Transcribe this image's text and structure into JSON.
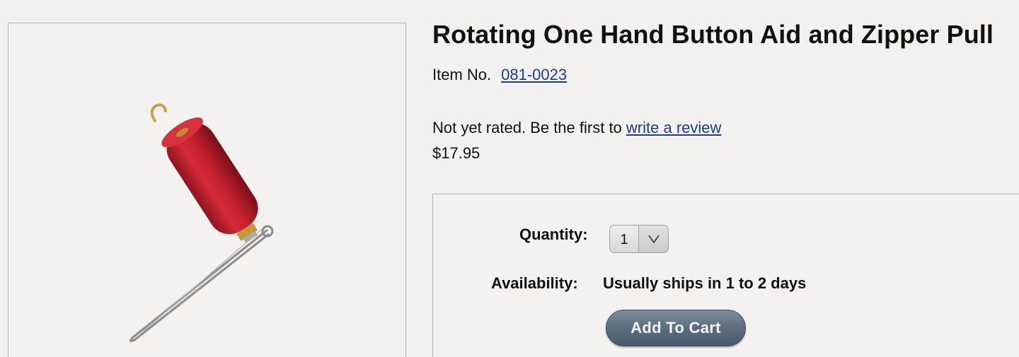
{
  "product": {
    "title": "Rotating One Hand Button Aid and Zipper Pull",
    "item_label": "Item No.",
    "item_number": "081-0023",
    "rating_text": "Not yet rated. Be the first to",
    "review_link": "write a review",
    "price": "$17.95",
    "image": {
      "alt": "red-handled button hook with wire loop",
      "handle_color": "#c9202f",
      "wire_color": "#9a9a9a",
      "ferrule_color": "#c39a3a"
    }
  },
  "purchase": {
    "quantity_label": "Quantity:",
    "quantity_value": "1",
    "availability_label": "Availability:",
    "availability_value": "Usually ships in 1 to 2 days",
    "add_to_cart_label": "Add To Cart"
  },
  "icons": {
    "dropdown": "chevron-down-icon"
  },
  "colors": {
    "link": "#1b3f86",
    "button": "#5c6d7f"
  }
}
